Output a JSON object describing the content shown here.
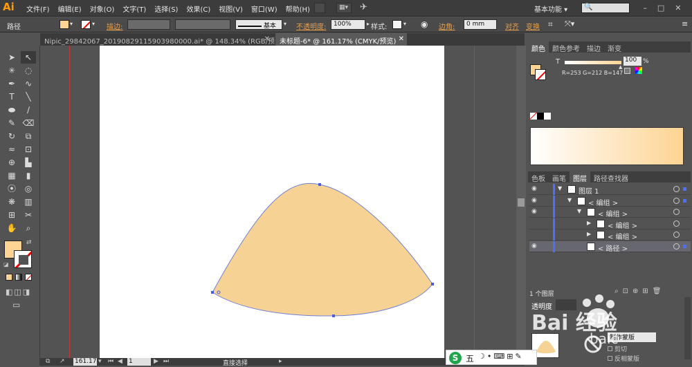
{
  "app": {
    "logo": "Ai",
    "workspace": "基本功能",
    "search_placeholder": ""
  },
  "menu": [
    "文件(F)",
    "编辑(E)",
    "对象(O)",
    "文字(T)",
    "选择(S)",
    "效果(C)",
    "视图(V)",
    "窗口(W)",
    "帮助(H)"
  ],
  "control_bar": {
    "selection_type": "路径",
    "stroke_label": "描边:",
    "brush_label": "基本",
    "opacity_label": "不透明度:",
    "opacity_value": "100%",
    "style_label": "样式:",
    "corner_label": "边角:",
    "corner_value": "0 mm",
    "align_label": "对齐",
    "transform_label": "变换",
    "fill_color": "#FDD493",
    "stroke_color": "none"
  },
  "tabs": [
    {
      "label": "Nipic_29842067_20190829115903980000.ai* @ 148.34% (RGB/预览)",
      "active": false
    },
    {
      "label": "未标题-6* @ 161.17% (CMYK/预览)",
      "active": true
    }
  ],
  "color_panel": {
    "tabs": [
      "颜色",
      "颜色参考",
      "描边",
      "渐变"
    ],
    "tint_label": "T",
    "tint_value": "100",
    "percent": "%",
    "rgb_readout": "R=253 G=212 B=147",
    "swatch_color": "#FDD493"
  },
  "layers_panel": {
    "tabs": [
      "色板",
      "画笔",
      "图层",
      "路径查找器"
    ],
    "rows": [
      {
        "indent": 0,
        "expander": "▼",
        "label": "图层 1",
        "visible": true
      },
      {
        "indent": 1,
        "expander": "▼",
        "label": "< 编组 >",
        "visible": true
      },
      {
        "indent": 2,
        "expander": "▼",
        "label": "< 编组 >",
        "visible": true
      },
      {
        "indent": 3,
        "expander": "▶",
        "label": "< 编组 >",
        "visible": false
      },
      {
        "indent": 3,
        "expander": "▶",
        "label": "< 编组 >",
        "visible": false
      },
      {
        "indent": 2,
        "expander": "",
        "label": "< 路径 >",
        "visible": true
      }
    ],
    "footer_count": "1 个图层"
  },
  "transparency_panel": {
    "tab": "透明度",
    "make_mask_button": "制作蒙版",
    "clip_label": "剪切",
    "invert_mask_label": "反相蒙版"
  },
  "status_bar": {
    "zoom": "161.17",
    "page": "1",
    "tool_name": "直接选择"
  },
  "taskbar": {
    "ime": "五"
  },
  "watermark": {
    "text": "Bai 经验",
    "sub": "baic"
  }
}
